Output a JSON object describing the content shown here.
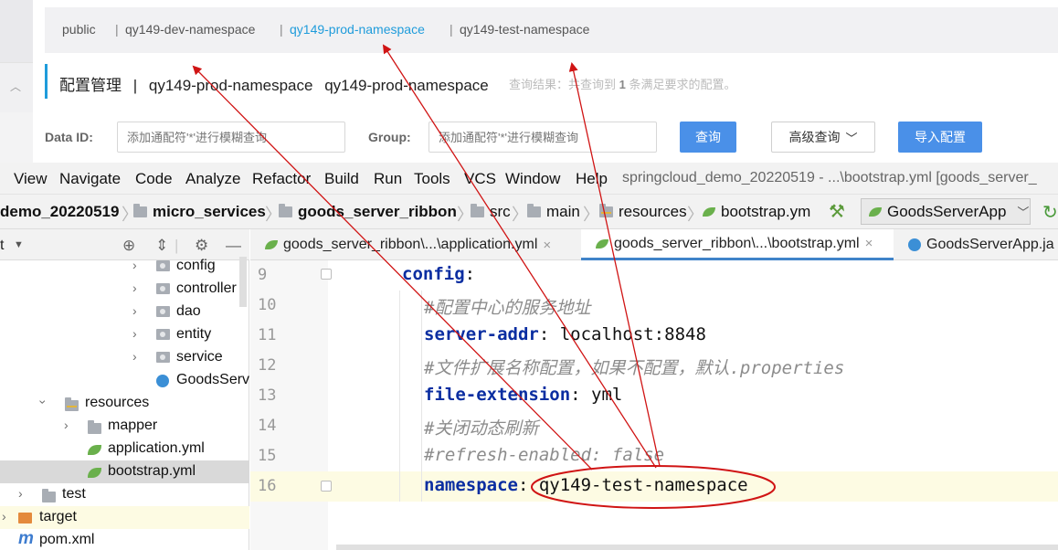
{
  "nacos": {
    "namespaces": [
      "public",
      "qy149-dev-namespace",
      "qy149-prod-namespace",
      "qy149-test-namespace"
    ],
    "active_namespace": "qy149-prod-namespace",
    "title_main": "配置管理",
    "title_sep": "|",
    "title_ns1": "qy149-prod-namespace",
    "title_ns2": "qy149-prod-namespace",
    "result_prefix": "查询结果：共查询到",
    "result_count": "1",
    "result_suffix": "条满足要求的配置。",
    "dataid_label": "Data ID:",
    "dataid_placeholder": "添加通配符'*'进行模糊查询",
    "group_label": "Group:",
    "group_placeholder": "添加通配符'*'进行模糊查询",
    "query_button": "查询",
    "advanced_button": "高级查询",
    "import_button": "导入配置",
    "accent_color": "#1f9cdb",
    "button_color": "#4a90e8"
  },
  "ide": {
    "menu": [
      "View",
      "Navigate",
      "Code",
      "Analyze",
      "Refactor",
      "Build",
      "Run",
      "Tools",
      "VCS",
      "Window",
      "Help"
    ],
    "window_title": "springcloud_demo_20220519 - ...\\bootstrap.yml [goods_server_",
    "breadcrumbs": [
      "demo_20220519",
      "micro_services",
      "goods_server_ribbon",
      "src",
      "main",
      "resources",
      "bootstrap.ym"
    ],
    "run_config": "GoodsServerApp",
    "project_header": "t",
    "tree": [
      {
        "label": "config",
        "icon": "package-folder-icon"
      },
      {
        "label": "controller",
        "icon": "package-folder-icon"
      },
      {
        "label": "dao",
        "icon": "package-folder-icon"
      },
      {
        "label": "entity",
        "icon": "package-folder-icon"
      },
      {
        "label": "service",
        "icon": "package-folder-icon"
      },
      {
        "label": "GoodsServ",
        "icon": "spring-class-icon"
      },
      {
        "label": "resources",
        "icon": "resources-folder-icon"
      },
      {
        "label": "mapper",
        "icon": "folder-icon"
      },
      {
        "label": "application.yml",
        "icon": "yml-file-icon"
      },
      {
        "label": "bootstrap.yml",
        "icon": "yml-file-icon"
      },
      {
        "label": "test",
        "icon": "folder-icon"
      },
      {
        "label": "target",
        "icon": "target-folder-icon"
      },
      {
        "label": "pom.xml",
        "icon": "maven-icon"
      }
    ],
    "tabs": [
      {
        "label": "goods_server_ribbon\\...\\application.yml",
        "close": "×"
      },
      {
        "label": "goods_server_ribbon\\...\\bootstrap.yml",
        "close": "×"
      },
      {
        "label": "GoodsServerApp.ja",
        "close": ""
      }
    ],
    "line_numbers": [
      "9",
      "10",
      "11",
      "12",
      "13",
      "14",
      "15",
      "16"
    ],
    "code": {
      "l9_key": "config",
      "l10_comment": "#配置中心的服务地址",
      "l11_key": "server-addr",
      "l11_val": "localhost:8848",
      "l12_comment": "#文件扩展名称配置，如果不配置，默认.properties",
      "l13_key": "file-extension",
      "l13_val": "yml",
      "l14_comment": "#关闭动态刷新",
      "l15_comment": "#refresh-enabled: false",
      "l16_key": "namespace",
      "l16_val": "qy149-test-namespace"
    },
    "annotation_color": "#d01414"
  }
}
